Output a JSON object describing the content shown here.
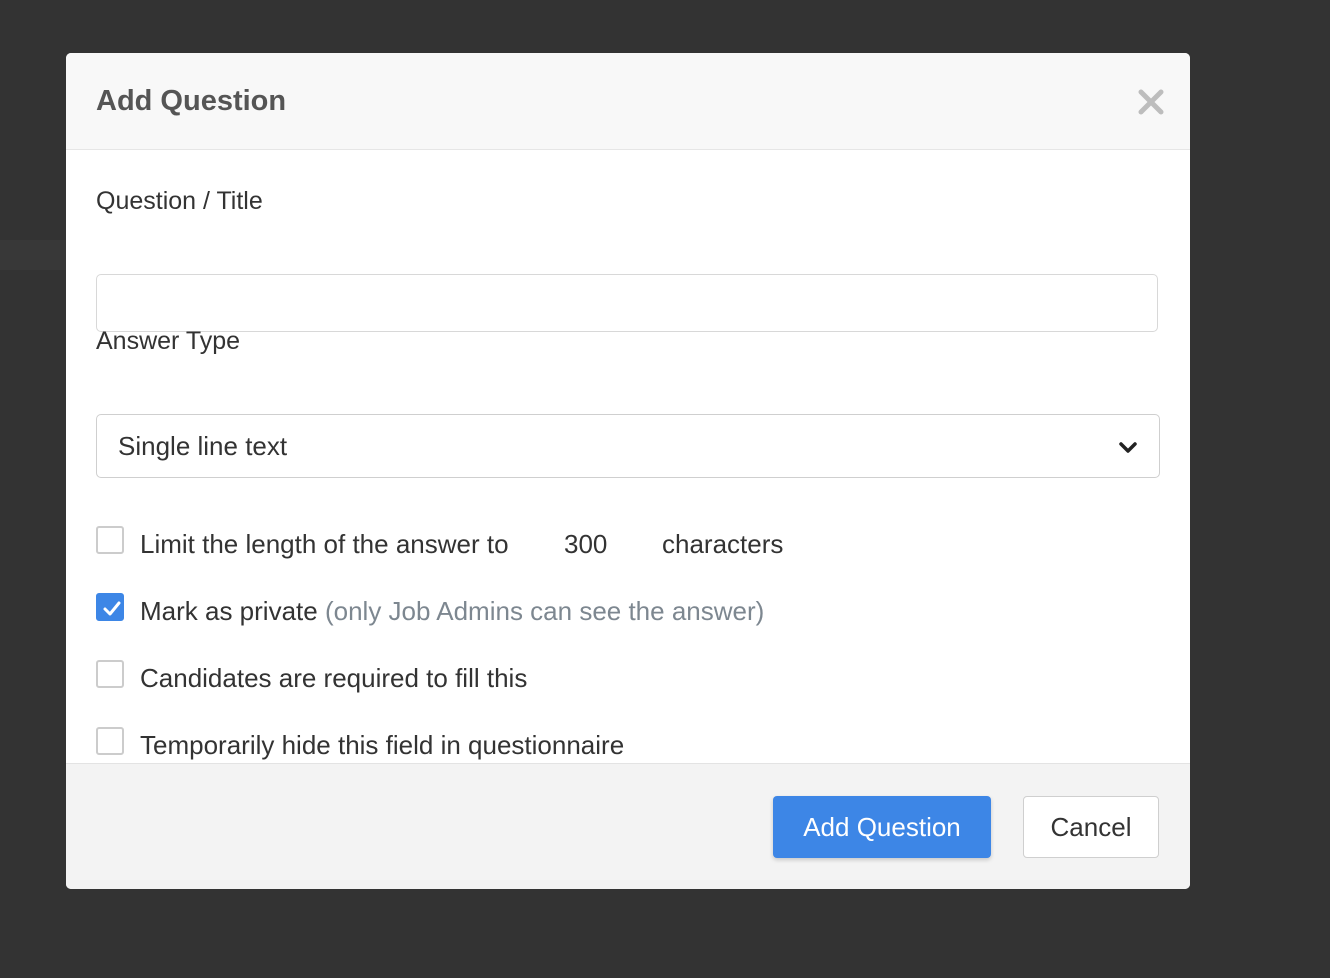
{
  "modal": {
    "title": "Add Question",
    "close_icon": "close-icon"
  },
  "form": {
    "question_label": "Question / Title",
    "question_value": "",
    "question_placeholder": "",
    "answer_type_label": "Answer Type",
    "answer_type_value": "Single line text",
    "answer_type_icon": "chevron-down-icon"
  },
  "options": {
    "limit_length": {
      "checked": false,
      "label": "Limit the length of the answer to",
      "limit_value": "300",
      "suffix": "characters"
    },
    "private": {
      "checked": true,
      "label": "Mark as private",
      "hint": "(only Job Admins can see the answer)"
    },
    "required": {
      "checked": false,
      "label": "Candidates are required to fill this"
    },
    "hide": {
      "checked": false,
      "label": "Temporarily hide this field in questionnaire"
    }
  },
  "footer": {
    "submit_label": "Add Question",
    "cancel_label": "Cancel"
  },
  "colors": {
    "backdrop": "#333333",
    "primary": "#3d86e6",
    "hint_text": "#7d8790"
  }
}
